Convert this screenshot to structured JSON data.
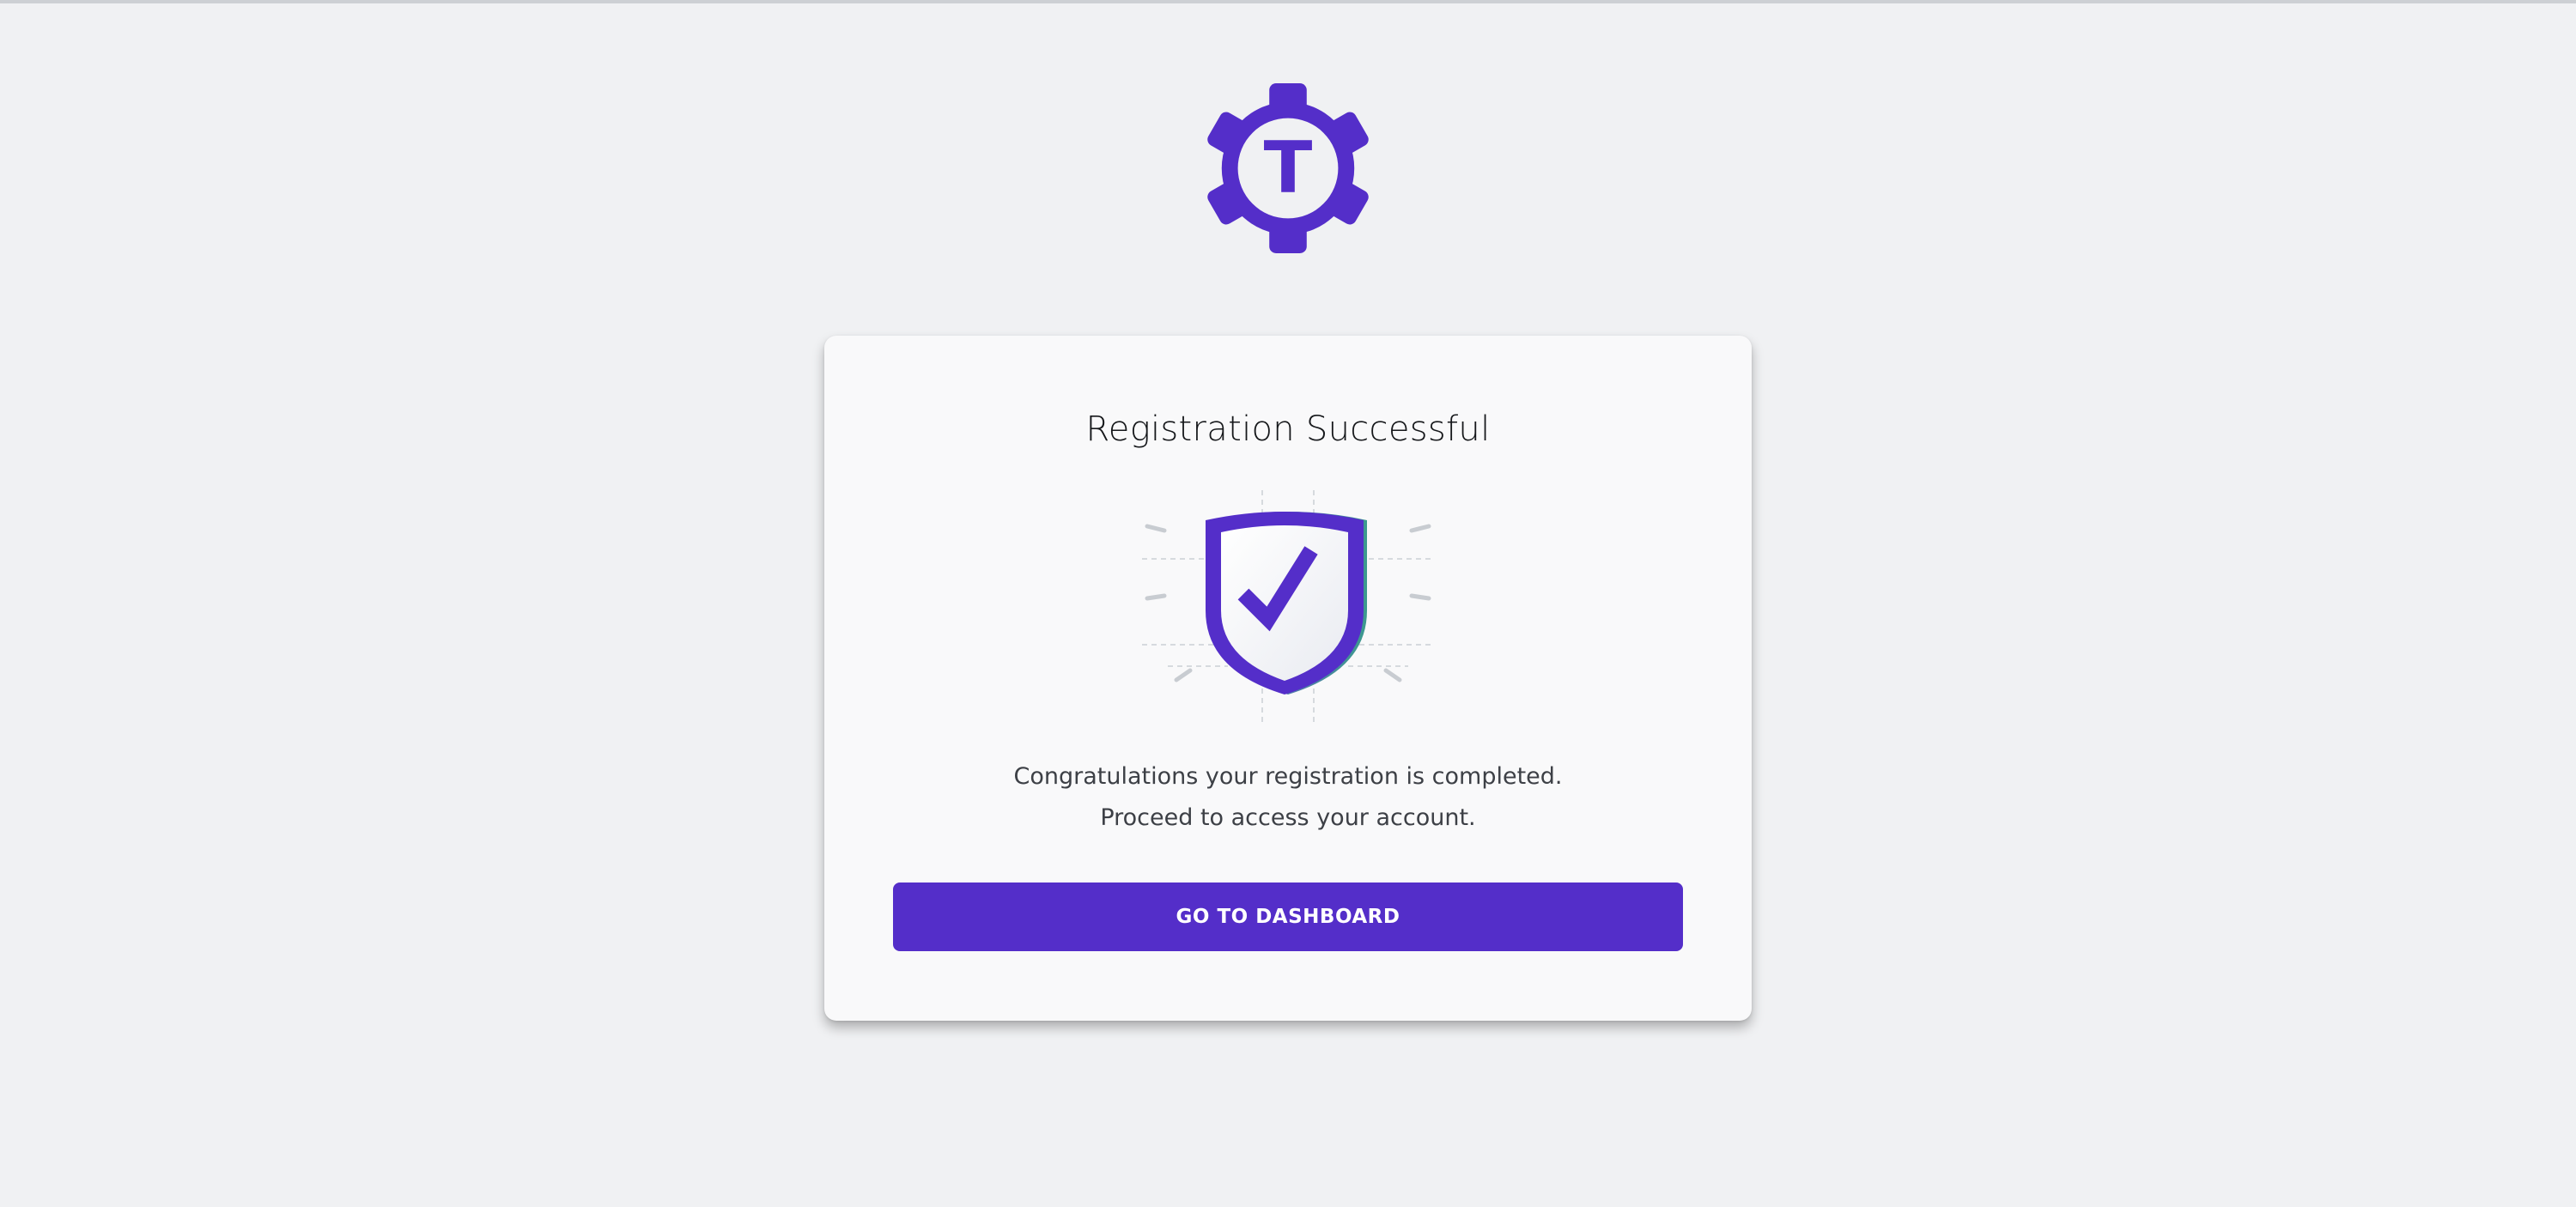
{
  "logo": {
    "icon": "gear-t-logo-icon",
    "letter": "T"
  },
  "card": {
    "title": "Registration Successful",
    "illustration_icon": "shield-check-icon",
    "message_line1": "Congratulations your registration is completed.",
    "message_line2": "Proceed to access your account.",
    "button_label": "GO TO DASHBOARD"
  },
  "colors": {
    "brand": "#542ec9",
    "background": "#f0f1f3",
    "card": "#f9f9fa",
    "text": "#3d4046"
  }
}
